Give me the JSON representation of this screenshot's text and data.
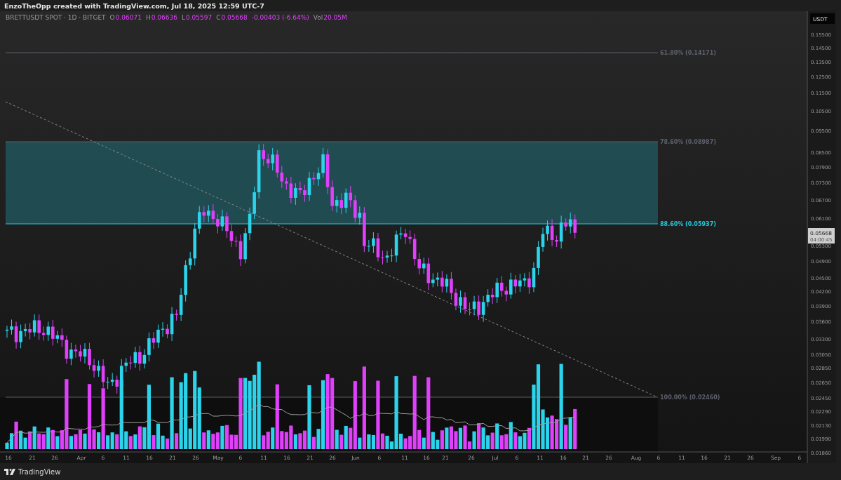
{
  "header": {
    "credit": "EnzoTheOpp created with TradingView.com, Jul 18, 2025 12:59 UTC-7"
  },
  "legend": {
    "symbol": "BRETTUSDT SPOT · 1D · BITGET",
    "fields": [
      {
        "label": "O",
        "value": "0.06071"
      },
      {
        "label": "H",
        "value": "0.06636"
      },
      {
        "label": "L",
        "value": "0.05597"
      },
      {
        "label": "C",
        "value": "0.05668"
      }
    ],
    "change": "-0.00403 (-6.64%)",
    "volume": {
      "label": "Vol",
      "value": "20.05M"
    }
  },
  "fib_levels": [
    {
      "label": "61.80% (0.14171)",
      "color": "#5d606b"
    },
    {
      "label": "78.60% (0.08987)",
      "color": "#5d606b"
    },
    {
      "label": "88.60% (0.05937)",
      "color": "#26c6da"
    },
    {
      "label": "100.00% (0.02460)",
      "color": "#5d606b"
    }
  ],
  "price_axis": {
    "currency": "USDT",
    "labels": [
      "0.15500",
      "0.14500",
      "0.13500",
      "0.12500",
      "0.11500",
      "0.10500",
      "0.09500",
      "0.08500",
      "0.07900",
      "0.07300",
      "0.06700",
      "0.06100",
      "0.05300",
      "0.04900",
      "0.04500",
      "0.04200",
      "0.03900",
      "0.03600",
      "0.03300",
      "0.03050",
      "0.02850",
      "0.02650",
      "0.02450",
      "0.02290",
      "0.02130",
      "0.01990",
      "0.01860"
    ],
    "current_price": {
      "value": "0.05668",
      "countdown": "04:00:45"
    }
  },
  "time_axis": {
    "labels": [
      "16",
      "21",
      "26",
      "Apr",
      "6",
      "11",
      "16",
      "21",
      "26",
      "May",
      "6",
      "11",
      "16",
      "21",
      "26",
      "Jun",
      "6",
      "11",
      "16",
      "21",
      "26",
      "Jul",
      "6",
      "11",
      "16",
      "21",
      "26",
      "Aug",
      "6",
      "11",
      "16",
      "21",
      "26",
      "Sep",
      "6"
    ]
  },
  "footer": {
    "brand": "TradingView"
  }
}
